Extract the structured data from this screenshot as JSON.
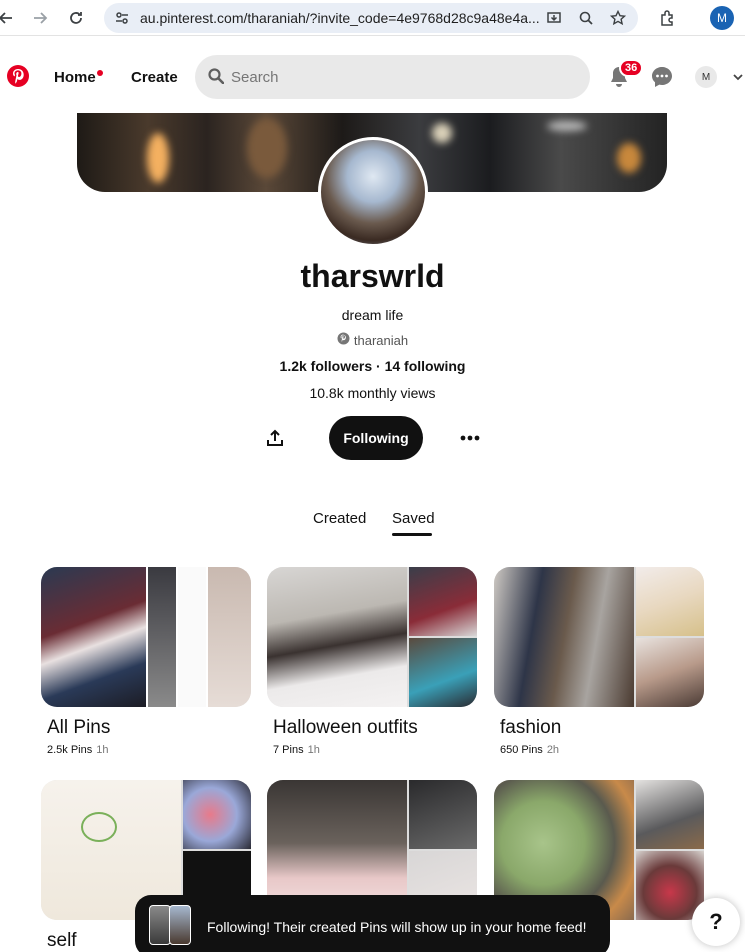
{
  "browser": {
    "url": "au.pinterest.com/tharaniah/?invite_code=4e9768d28c9a48e4a...",
    "profile_initial": "M"
  },
  "header": {
    "nav": [
      "Home",
      "Create"
    ],
    "search_placeholder": "Search",
    "notification_count": "36",
    "avatar_initial": "M"
  },
  "profile": {
    "name": "tharswrld",
    "bio": "dream life",
    "handle": "tharaniah",
    "stats": "1.2k followers · 14 following",
    "monthly_views": "10.8k monthly views",
    "follow_label": "Following"
  },
  "tabs": [
    "Created",
    "Saved"
  ],
  "active_tab": "Saved",
  "boards": [
    {
      "title": "All Pins",
      "count": "2.5k Pins",
      "ago": "1h"
    },
    {
      "title": "Halloween outfits",
      "count": "7 Pins",
      "ago": "1h"
    },
    {
      "title": "fashion",
      "count": "650 Pins",
      "ago": "2h"
    },
    {
      "title": "self",
      "count": "",
      "ago": ""
    }
  ],
  "toast": {
    "message": "Following! Their created Pins will show up in your home feed!"
  },
  "help": {
    "label": "?"
  },
  "colors": {
    "brand": "#e60023",
    "dark": "#111111",
    "search_bg": "#e9e9e9",
    "browser_accent": "#1a63b3"
  }
}
